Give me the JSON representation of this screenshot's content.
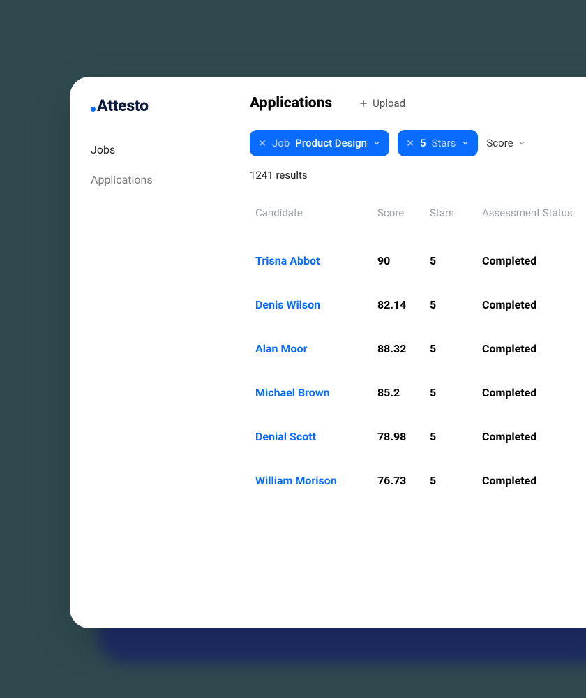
{
  "brand": {
    "name": "Attesto"
  },
  "sidebar": {
    "items": [
      {
        "label": "Jobs"
      },
      {
        "label": "Applications"
      }
    ]
  },
  "header": {
    "title": "Applications",
    "upload_label": "Upload"
  },
  "filters": {
    "job": {
      "label": "Job",
      "value": "Product Design"
    },
    "stars": {
      "label": "Stars",
      "value": "5"
    },
    "sort_label": "Score"
  },
  "results_text": "1241 results",
  "columns": {
    "candidate": "Candidate",
    "score": "Score",
    "stars": "Stars",
    "status": "Assessment Status"
  },
  "rows": [
    {
      "candidate": "Trisna Abbot",
      "score": "90",
      "stars": "5",
      "status": "Completed"
    },
    {
      "candidate": "Denis Wilson",
      "score": "82.14",
      "stars": "5",
      "status": "Completed"
    },
    {
      "candidate": "Alan Moor",
      "score": "88.32",
      "stars": "5",
      "status": "Completed"
    },
    {
      "candidate": "Michael Brown",
      "score": "85.2",
      "stars": "5",
      "status": "Completed"
    },
    {
      "candidate": "Denial Scott",
      "score": "78.98",
      "stars": "5",
      "status": "Completed"
    },
    {
      "candidate": "William Morison",
      "score": "76.73",
      "stars": "5",
      "status": "Completed"
    }
  ]
}
